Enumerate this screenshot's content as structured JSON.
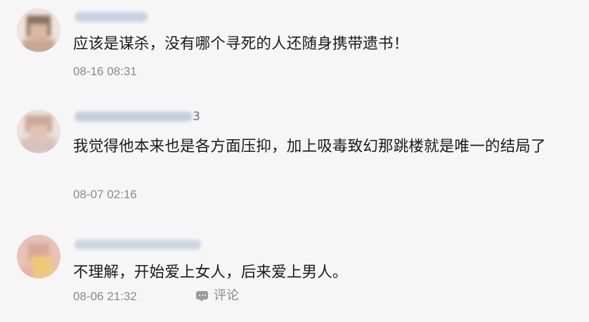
{
  "comments": [
    {
      "text": "应该是谋杀，没有哪个寻死的人还随身携带遗书！",
      "time": "08-16 08:31",
      "username_tail": "",
      "avatar_icon": "user-avatar-icon"
    },
    {
      "text": "我觉得他本来也是各方面压抑，加上吸毒致幻那跳楼就是唯一的结局了",
      "time": "08-07 02:16",
      "username_tail": "3",
      "avatar_icon": "user-avatar-icon"
    },
    {
      "text": "不理解，开始爱上女人，后来爱上男人。",
      "time": "08-06 21:32",
      "username_tail": "",
      "avatar_icon": "user-avatar-icon",
      "reply_label": "评论",
      "reply_icon": "comment-bubble-icon"
    }
  ],
  "colors": {
    "background": "#f6f6f6",
    "username": "#5a6f8c",
    "text": "#1a1a1a",
    "meta": "#8a8a8a"
  }
}
